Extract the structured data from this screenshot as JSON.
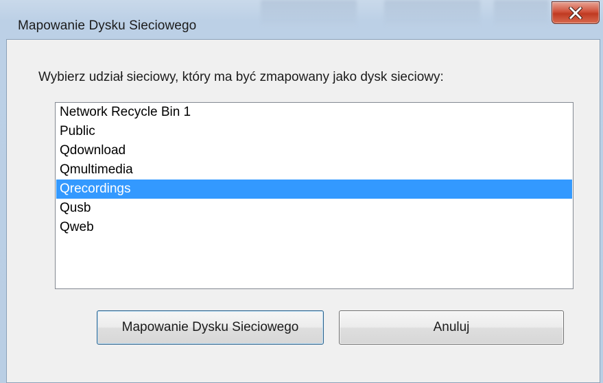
{
  "window": {
    "title": "Mapowanie Dysku Sieciowego"
  },
  "dialog": {
    "prompt": "Wybierz udział sieciowy, który ma być zmapowany jako dysk sieciowy:",
    "shares": [
      {
        "label": "Network Recycle Bin 1",
        "selected": false
      },
      {
        "label": "Public",
        "selected": false
      },
      {
        "label": "Qdownload",
        "selected": false
      },
      {
        "label": "Qmultimedia",
        "selected": false
      },
      {
        "label": "Qrecordings",
        "selected": true
      },
      {
        "label": "Qusb",
        "selected": false
      },
      {
        "label": "Qweb",
        "selected": false
      }
    ],
    "map_button_label": "Mapowanie Dysku Sieciowego",
    "cancel_button_label": "Anuluj"
  },
  "colors": {
    "selection": "#3399ff",
    "close_button": "#c9432b"
  },
  "icons": {
    "close": "close-icon"
  }
}
